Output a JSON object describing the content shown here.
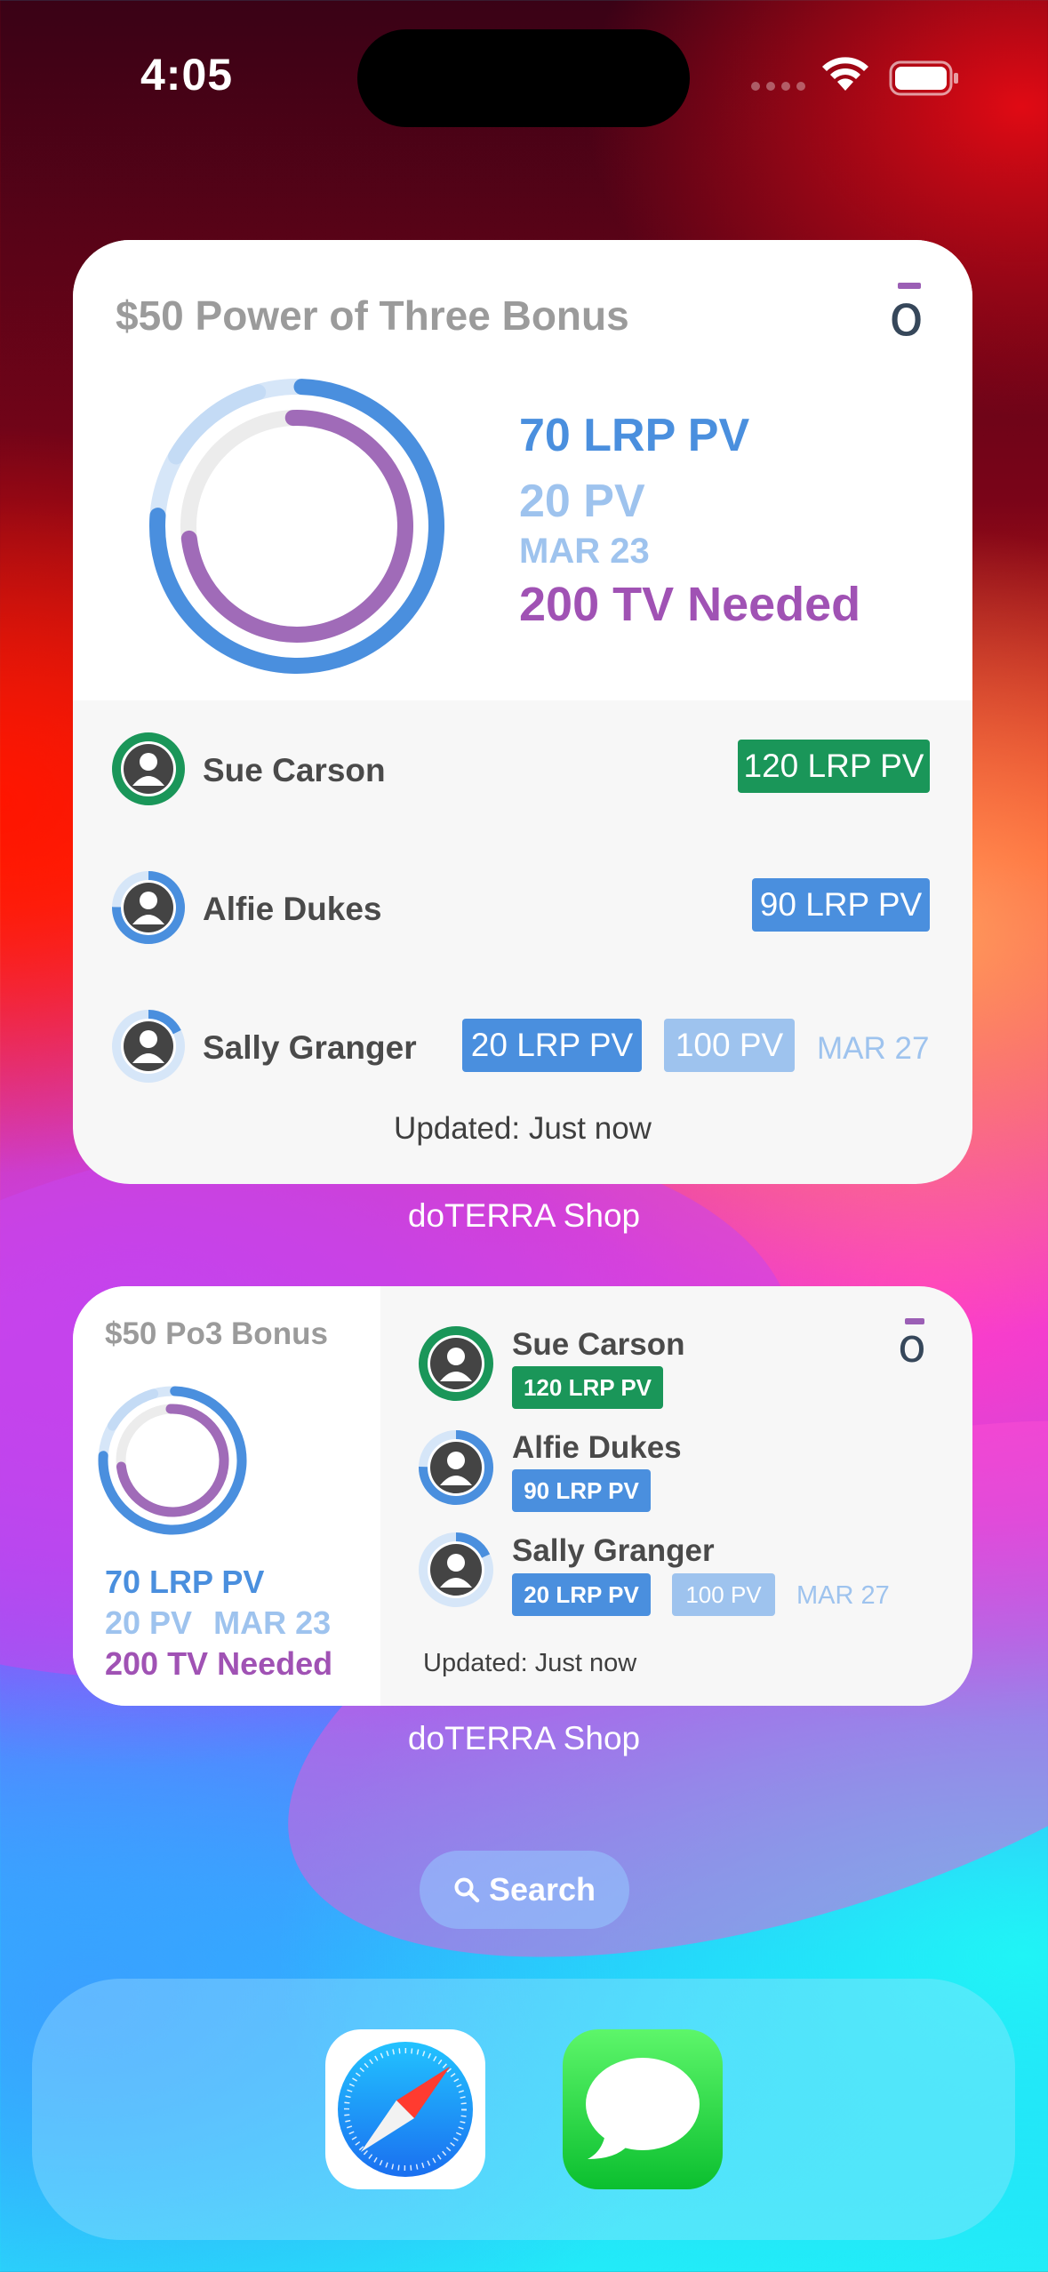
{
  "status_bar": {
    "time": "4:05"
  },
  "widget_large": {
    "title": "$50 Power of Three Bonus",
    "logo_letter": "o",
    "stats": {
      "lrp_pv": "70 LRP PV",
      "pv": "20 PV",
      "date": "MAR 23",
      "tv_needed": "200 TV Needed"
    },
    "members": [
      {
        "name": "Sue Carson",
        "badge": "120 LRP PV",
        "badge_color": "#1a9659"
      },
      {
        "name": "Alfie Dukes",
        "badge": "90 LRP PV",
        "badge_color": "#4a8fde"
      },
      {
        "name": "Sally Granger",
        "badge": "20 LRP PV",
        "badge_color": "#4a8fde",
        "pv_badge": "100 PV",
        "date": "MAR 27"
      }
    ],
    "updated": "Updated: Just now",
    "app_label": "doTERRA Shop"
  },
  "widget_medium": {
    "title": "$50 Po3 Bonus",
    "logo_letter": "o",
    "stats": {
      "lrp_pv": "70 LRP PV",
      "pv": "20 PV",
      "date": "MAR 23",
      "tv_needed": "200 TV Needed"
    },
    "members": [
      {
        "name": "Sue Carson",
        "badge": "120 LRP PV"
      },
      {
        "name": "Alfie Dukes",
        "badge": "90 LRP PV"
      },
      {
        "name": "Sally Granger",
        "badge": "20 LRP PV",
        "pv_badge": "100 PV",
        "date": "MAR 27"
      }
    ],
    "updated": "Updated: Just now",
    "app_label": "doTERRA Shop"
  },
  "search": {
    "label": "Search",
    "icon": "magnifying-glass"
  },
  "dock": {
    "apps": [
      {
        "icon": "safari-compass"
      },
      {
        "icon": "messages-bubble"
      }
    ]
  },
  "colors": {
    "lrp_blue": "#4a8fde",
    "pv_light_blue": "#9ec3ee",
    "tv_purple": "#a052b4",
    "qualified_green": "#1a9659"
  }
}
